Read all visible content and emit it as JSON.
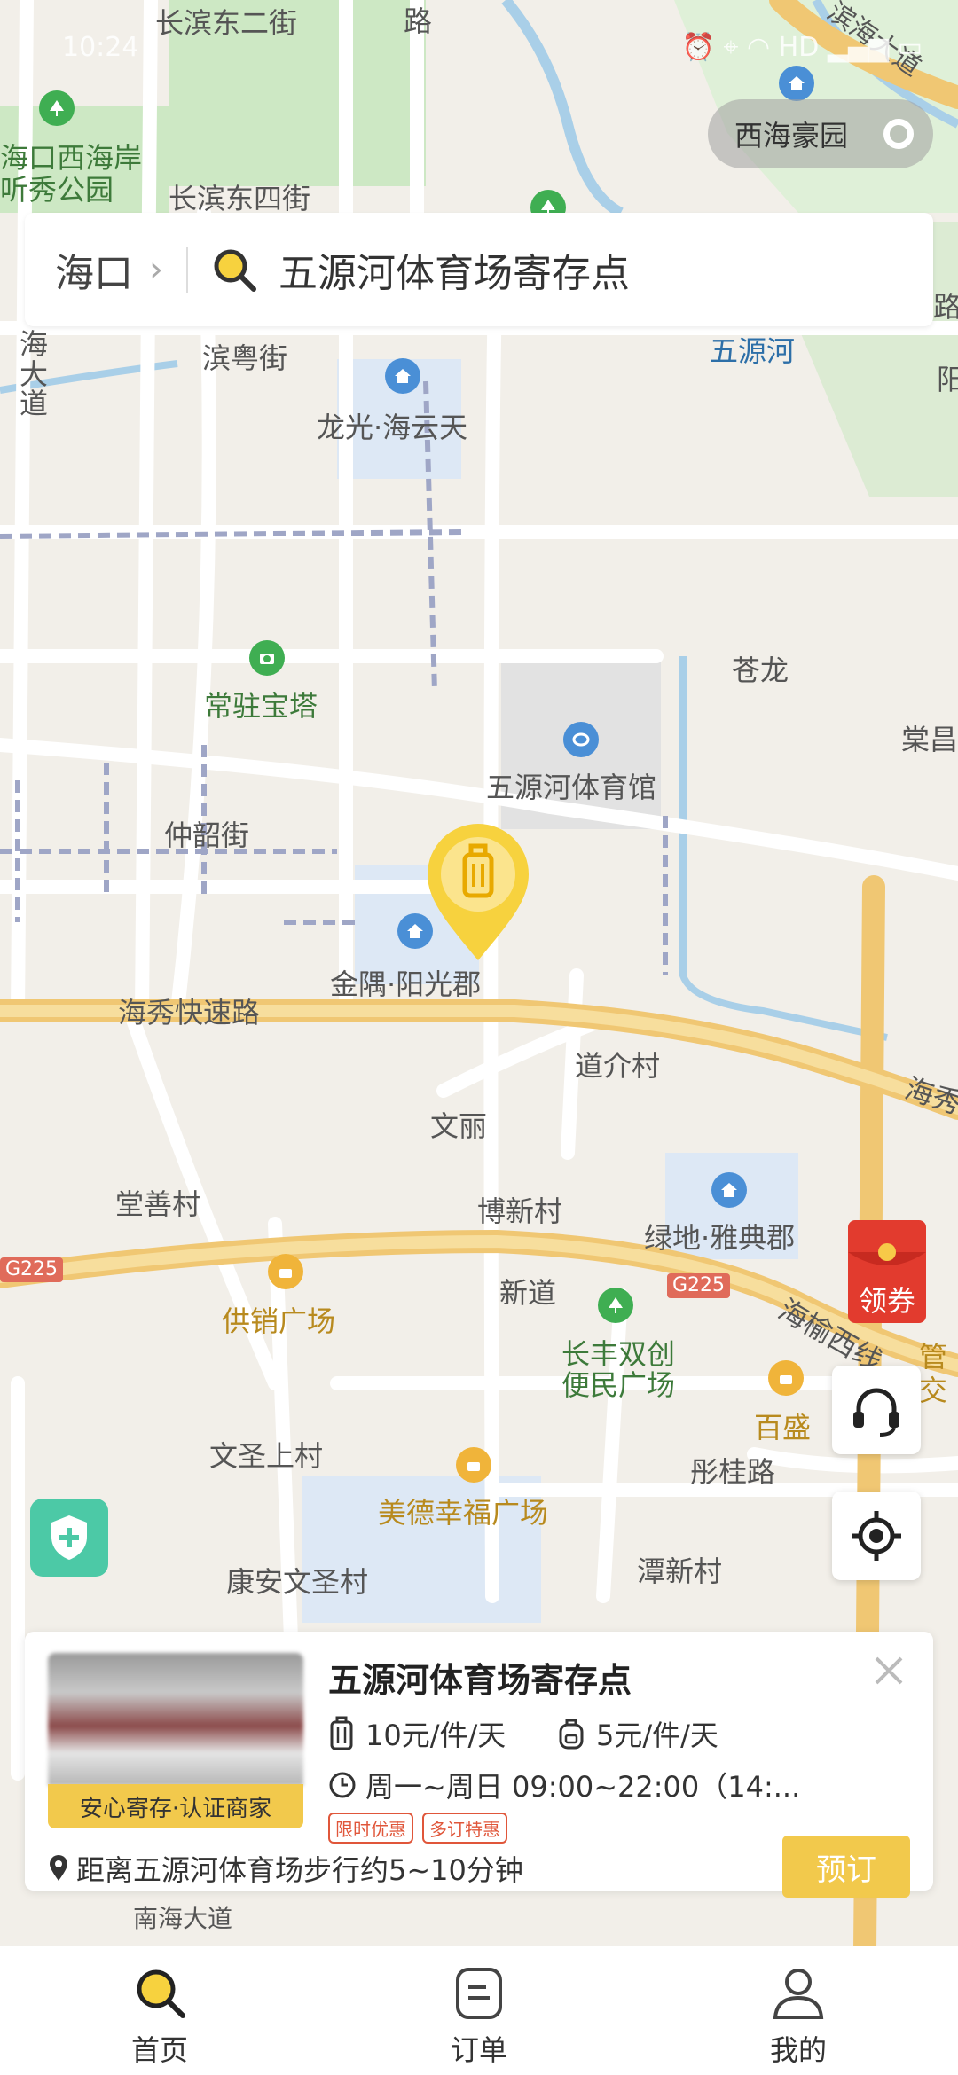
{
  "status_bar": {
    "time": "10:24",
    "indicators": "HD"
  },
  "search": {
    "city": "海口",
    "query": "五源河体育场寄存点"
  },
  "community_pill": "西海豪园",
  "map_labels": {
    "changbin_dong_2": "长滨东二街",
    "changbin_dong_4": "长滨东四街",
    "lu": "路",
    "binhai_dadao": "滨海大道",
    "haikou_xihai": "海口西海岸",
    "tingxiu_park": "听秀公园",
    "binyue_st": "滨粤街",
    "longguang": "龙光·海云天",
    "wuyuan_river": "五源河",
    "cangyu": "苍龙",
    "tang_chang": "棠昌",
    "changzhu_baota": "常驻宝塔",
    "wuyuan_gym": "五源河体育馆",
    "zhongshao_st": "仲韶街",
    "jinyu_yangguang": "金隅·阳光郡",
    "haixiu_expressway": "海秀快速路",
    "haixiu": "海秀",
    "daojie_village": "道介村",
    "wenli": "文丽",
    "tangshan_village": "堂善村",
    "boxin_village": "博新村",
    "lvdi_yadian": "绿地·雅典郡",
    "g225_left": "G225",
    "g225_right": "G225",
    "gongxiao_plaza": "供销广场",
    "xindao": "新道",
    "haiyu_west": "海榆西线",
    "changfeng": "长丰双创便民广场",
    "baisheng": "百盛",
    "guan": "管",
    "jiao": "交",
    "wensheng_shang": "文圣上村",
    "tonggui_rd": "彤桂路",
    "meide_plaza": "美德幸福广场",
    "kangan_wensheng": "康安文圣村",
    "tanxin_village": "潭新村",
    "haizhi": "海大道",
    "lu_right": "路",
    "yang": "阳",
    "nanhai": "南海大道"
  },
  "coupon_label": "领券",
  "store_card": {
    "name": "五源河体育场寄存点",
    "tag": "安心寄存·认证商家",
    "price_large": "10元/件/天",
    "price_small": "5元/件/天",
    "hours": "周一~周日 09:00~22:00（14:...",
    "badges": [
      "限时优惠",
      "多订特惠"
    ],
    "distance": "距离五源河体育场步行约5~10分钟",
    "book_label": "预订"
  },
  "nav": {
    "home": "首页",
    "orders": "订单",
    "mine": "我的"
  },
  "colors": {
    "accent": "#f2c94c",
    "road": "#f5d37a",
    "water": "#a9cfe8",
    "park": "#cde8c4"
  }
}
